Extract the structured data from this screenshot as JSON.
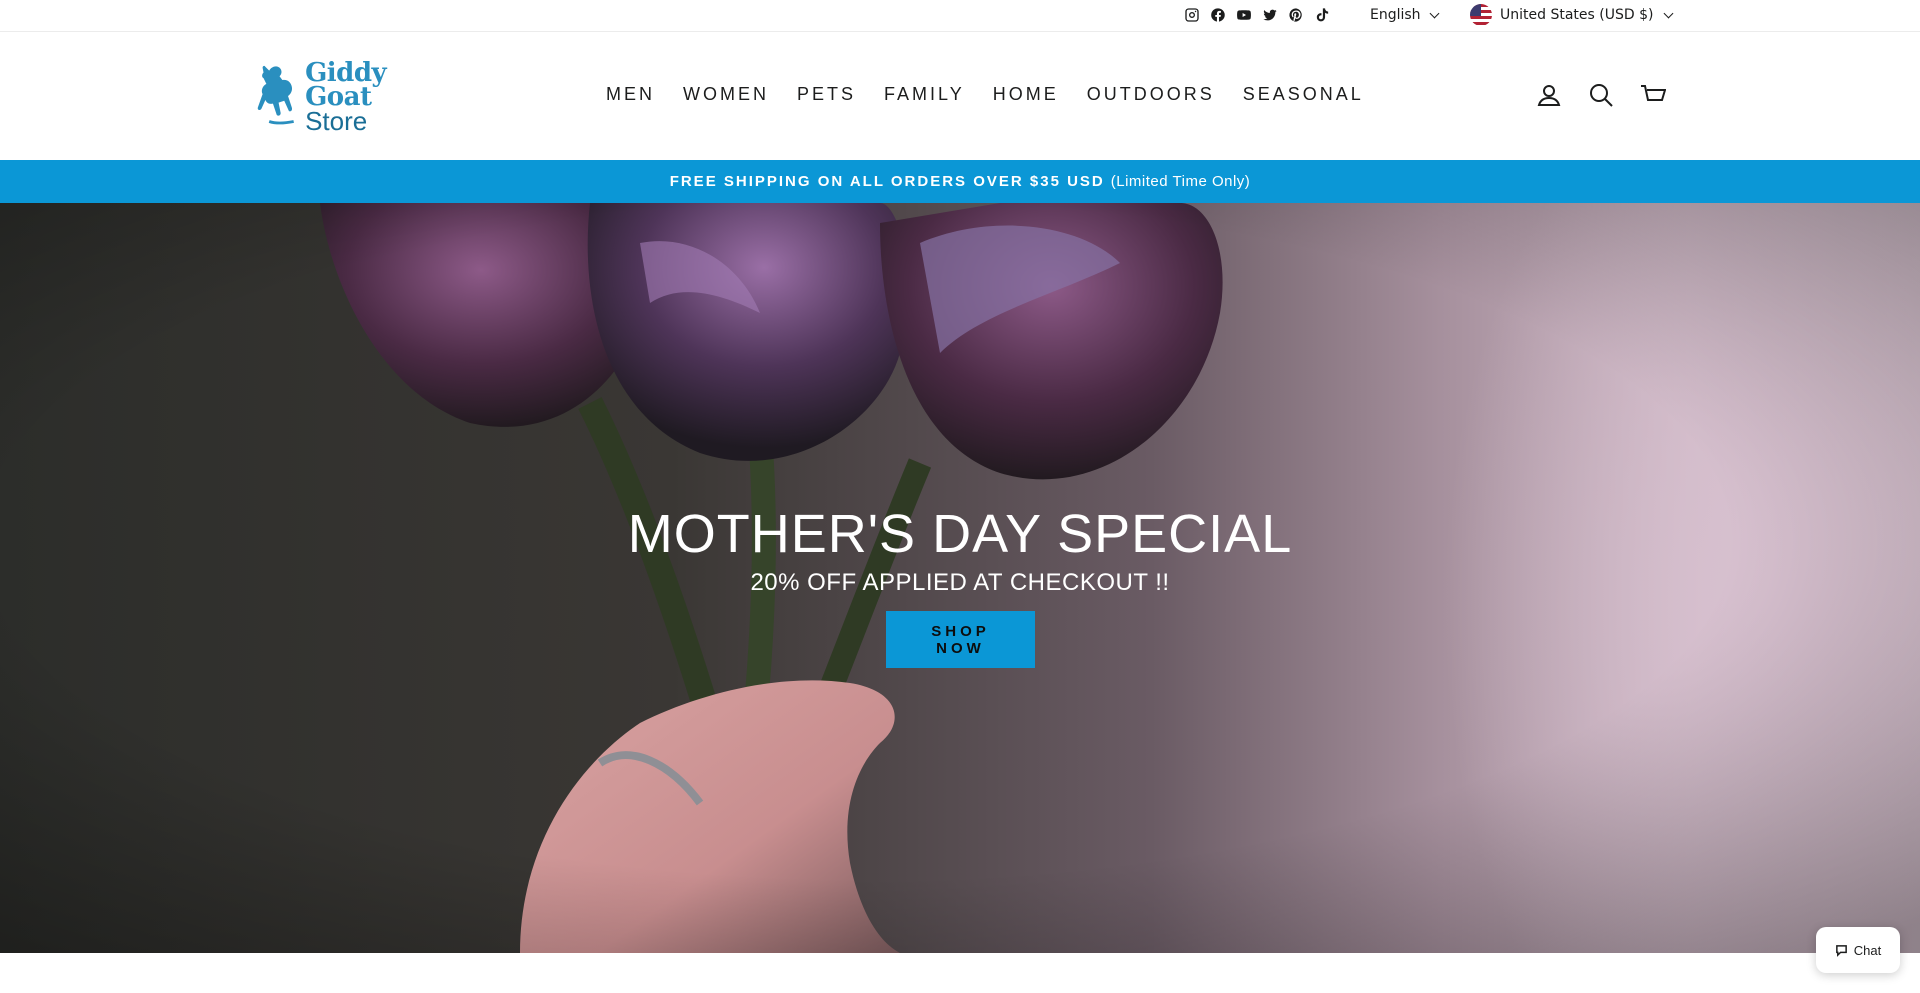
{
  "utility": {
    "social_icons": [
      "instagram-icon",
      "facebook-icon",
      "youtube-icon",
      "twitter-icon",
      "pinterest-icon",
      "tiktok-icon"
    ],
    "language": "English",
    "currency": "United States (USD $)"
  },
  "header": {
    "logo": {
      "line1": "Giddy Goat",
      "line2": "Store"
    },
    "nav": [
      "MEN",
      "WOMEN",
      "PETS",
      "FAMILY",
      "HOME",
      "OUTDOORS",
      "SEASONAL"
    ],
    "icons": [
      "account-icon",
      "search-icon",
      "cart-icon"
    ]
  },
  "announcement": {
    "strong": "FREE SHIPPING ON ALL ORDERS OVER $35 USD",
    "light": "(Limited Time Only)"
  },
  "hero": {
    "title": "MOTHER'S DAY SPECIAL",
    "subtitle": "20% OFF APPLIED AT CHECKOUT !!",
    "button": "SHOP NOW"
  },
  "chat": {
    "label": "Chat"
  },
  "colors": {
    "accent": "#0b97d6",
    "logo": "#2a8fbf"
  }
}
